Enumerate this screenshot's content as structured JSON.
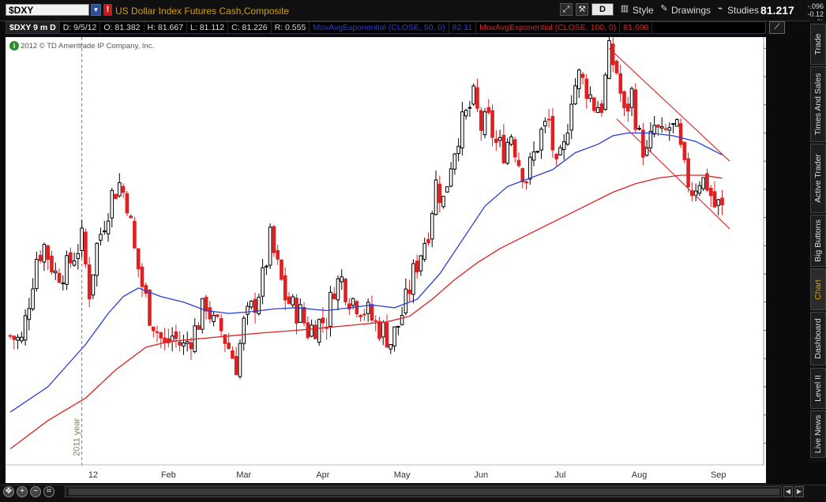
{
  "header": {
    "symbol": "$DXY",
    "description": "US Dollar Index Futures Cash,Composite",
    "alert_icon": "alert-icon",
    "toolbar": {
      "draw_style_glyph": "D",
      "style_label": "Style",
      "drawings_label": "Drawings",
      "studies_label": "Studies"
    },
    "last_price": "81.217",
    "net_change": "-.096",
    "net_change_pct": "-0.12 %"
  },
  "study_bar": {
    "symbol_period": "$DXY 9 m D",
    "date": "D: 9/5/12",
    "open": "O: 81.382",
    "high": "H: 81.667",
    "low": "L: 81.112",
    "close": "C: 81.226",
    "range": "R: 0.555",
    "ema50_label": "MovAvgExponential (CLOSE, 50, 0)",
    "ema50_value": "82.11",
    "ema100_label": "MovAvgExponential (CLOSE, 100, 0)",
    "ema100_value": "81.698"
  },
  "copyright": "2012 © TD Ameritrade IP Company, Inc.",
  "side_tabs": [
    "Trade",
    "Times And Sales",
    "Active Trader",
    "Big Buttons",
    "Chart",
    "Dashboard",
    "Level II",
    "Live News"
  ],
  "active_tab": "Chart",
  "colors": {
    "bull": "#000000",
    "bear": "#e02020",
    "ema50": "#2a3cdc",
    "ema100": "#e02020",
    "trend": "#e02020",
    "year_marker": "#8a7a60"
  },
  "chart_data": {
    "type": "candlestick",
    "title": "",
    "ylim": [
      76.6,
      84.2
    ],
    "y_ticks": [
      "77",
      "77.5",
      "78",
      "78.5",
      "79",
      "79.5",
      "80",
      "80.5",
      "81",
      "81.5",
      "82",
      "82.5",
      "83",
      "83.5",
      "84"
    ],
    "x_tick_labels": [
      "12",
      "Feb",
      "Mar",
      "Apr",
      "May",
      "Jun",
      "Jul",
      "Aug",
      "Sep"
    ],
    "x_tick_index": [
      22,
      42,
      62,
      83,
      104,
      125,
      146,
      167,
      188
    ],
    "year_marker": {
      "label": "2011 year",
      "index": 19
    },
    "series_close_trajectory": [
      [
        0,
        78.9
      ],
      [
        3,
        78.8
      ],
      [
        7,
        80.3
      ],
      [
        9,
        80.5
      ],
      [
        12,
        80.0
      ],
      [
        15,
        80.1
      ],
      [
        19,
        80.6
      ],
      [
        21,
        79.7
      ],
      [
        23,
        80.5
      ],
      [
        27,
        81.4
      ],
      [
        29,
        81.6
      ],
      [
        31,
        81.3
      ],
      [
        33,
        80.4
      ],
      [
        35,
        79.8
      ],
      [
        37,
        79.3
      ],
      [
        39,
        79.0
      ],
      [
        41,
        78.7
      ],
      [
        43,
        78.9
      ],
      [
        46,
        78.7
      ],
      [
        49,
        79.0
      ],
      [
        52,
        79.5
      ],
      [
        54,
        79.1
      ],
      [
        56,
        79.0
      ],
      [
        58,
        78.7
      ],
      [
        60,
        78.4
      ],
      [
        62,
        79.1
      ],
      [
        65,
        79.5
      ],
      [
        67,
        79.9
      ],
      [
        69,
        80.6
      ],
      [
        71,
        80.1
      ],
      [
        73,
        79.6
      ],
      [
        75,
        79.4
      ],
      [
        77,
        79.3
      ],
      [
        79,
        79.0
      ],
      [
        81,
        79.1
      ],
      [
        84,
        79.2
      ],
      [
        86,
        79.8
      ],
      [
        88,
        79.9
      ],
      [
        90,
        79.6
      ],
      [
        92,
        79.5
      ],
      [
        95,
        79.3
      ],
      [
        97,
        79.1
      ],
      [
        99,
        79.0
      ],
      [
        101,
        78.8
      ],
      [
        103,
        79.1
      ],
      [
        105,
        79.5
      ],
      [
        107,
        80.0
      ],
      [
        109,
        80.4
      ],
      [
        111,
        80.8
      ],
      [
        113,
        81.6
      ],
      [
        115,
        81.3
      ],
      [
        117,
        82.0
      ],
      [
        119,
        82.5
      ],
      [
        121,
        82.8
      ],
      [
        123,
        83.1
      ],
      [
        125,
        82.6
      ],
      [
        127,
        82.7
      ],
      [
        129,
        82.3
      ],
      [
        131,
        82.2
      ],
      [
        133,
        82.5
      ],
      [
        135,
        82.0
      ],
      [
        137,
        81.7
      ],
      [
        139,
        82.1
      ],
      [
        141,
        82.5
      ],
      [
        143,
        82.7
      ],
      [
        145,
        81.8
      ],
      [
        147,
        82.2
      ],
      [
        149,
        83.2
      ],
      [
        151,
        83.5
      ],
      [
        153,
        83.3
      ],
      [
        155,
        83.0
      ],
      [
        157,
        83.0
      ],
      [
        159,
        83.9
      ],
      [
        161,
        83.6
      ],
      [
        163,
        82.8
      ],
      [
        165,
        83.2
      ],
      [
        167,
        82.4
      ],
      [
        169,
        82.1
      ],
      [
        171,
        82.6
      ],
      [
        173,
        82.4
      ],
      [
        175,
        82.6
      ],
      [
        177,
        82.5
      ],
      [
        179,
        81.8
      ],
      [
        181,
        81.5
      ],
      [
        183,
        81.7
      ],
      [
        185,
        81.6
      ],
      [
        187,
        81.2
      ],
      [
        189,
        81.226
      ]
    ],
    "ema50": [
      [
        0,
        77.55
      ],
      [
        10,
        78.0
      ],
      [
        20,
        78.75
      ],
      [
        26,
        79.3
      ],
      [
        30,
        79.6
      ],
      [
        34,
        79.75
      ],
      [
        40,
        79.6
      ],
      [
        46,
        79.5
      ],
      [
        52,
        79.35
      ],
      [
        58,
        79.3
      ],
      [
        64,
        79.33
      ],
      [
        70,
        79.38
      ],
      [
        76,
        79.4
      ],
      [
        84,
        79.35
      ],
      [
        90,
        79.4
      ],
      [
        96,
        79.45
      ],
      [
        102,
        79.4
      ],
      [
        108,
        79.55
      ],
      [
        114,
        80.0
      ],
      [
        120,
        80.6
      ],
      [
        126,
        81.2
      ],
      [
        132,
        81.55
      ],
      [
        138,
        81.7
      ],
      [
        144,
        81.85
      ],
      [
        150,
        82.15
      ],
      [
        156,
        82.3
      ],
      [
        160,
        82.45
      ],
      [
        164,
        82.5
      ],
      [
        170,
        82.5
      ],
      [
        176,
        82.45
      ],
      [
        182,
        82.35
      ],
      [
        189,
        82.11
      ]
    ],
    "ema100": [
      [
        0,
        76.9
      ],
      [
        10,
        77.4
      ],
      [
        20,
        77.8
      ],
      [
        28,
        78.3
      ],
      [
        36,
        78.7
      ],
      [
        42,
        78.8
      ],
      [
        50,
        78.85
      ],
      [
        58,
        78.9
      ],
      [
        66,
        78.95
      ],
      [
        76,
        79.0
      ],
      [
        84,
        79.05
      ],
      [
        92,
        79.1
      ],
      [
        100,
        79.15
      ],
      [
        106,
        79.25
      ],
      [
        112,
        79.55
      ],
      [
        118,
        79.9
      ],
      [
        124,
        80.2
      ],
      [
        130,
        80.45
      ],
      [
        136,
        80.65
      ],
      [
        142,
        80.85
      ],
      [
        148,
        81.05
      ],
      [
        154,
        81.25
      ],
      [
        160,
        81.45
      ],
      [
        166,
        81.6
      ],
      [
        172,
        81.7
      ],
      [
        178,
        81.75
      ],
      [
        184,
        81.75
      ],
      [
        189,
        81.698
      ]
    ],
    "trend_channel": [
      {
        "from": [
          159,
          84.0
        ],
        "to": [
          191,
          82.0
        ]
      },
      {
        "from": [
          161,
          82.75
        ],
        "to": [
          191,
          80.8
        ]
      }
    ],
    "price_labels": [
      {
        "value": "82.11",
        "level": 82.11,
        "color": "#2a3cdc"
      },
      {
        "value": "81.698",
        "level": 81.698,
        "color": "#e02020"
      },
      {
        "value": "81.226",
        "level": 81.226,
        "color": "#e02020"
      }
    ],
    "grid": false,
    "legend": "none"
  }
}
